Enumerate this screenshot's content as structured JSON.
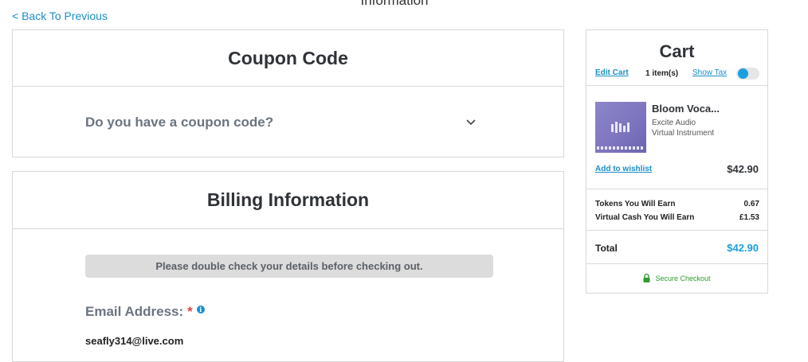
{
  "page": {
    "top_title": "Information",
    "back_link": "< Back To Previous"
  },
  "coupon": {
    "heading": "Coupon Code",
    "question": "Do you have a coupon code?"
  },
  "billing": {
    "heading": "Billing Information",
    "notice": "Please double check your details before checking out.",
    "email_label": "Email Address:",
    "required_mark": "*",
    "info_mark": "i",
    "email_value": "seafly314@live.com"
  },
  "cart": {
    "title": "Cart",
    "edit_cart": "Edit Cart",
    "item_count": "1 item(s)",
    "show_tax": "Show Tax",
    "show_tax_on": true,
    "item": {
      "name": "Bloom Voca...",
      "brand": "Excite Audio",
      "type": "Virtual Instrument",
      "price": "$42.90",
      "wishlist": "Add to wishlist"
    },
    "tokens_label": "Tokens You Will Earn",
    "tokens_value": "0.67",
    "vcash_label": "Virtual Cash You Will Earn",
    "vcash_value": "£1.53",
    "total_label": "Total",
    "total_value": "$42.90",
    "secure_checkout": "Secure Checkout"
  },
  "colors": {
    "accent": "#1a8fc9",
    "secure": "#2e9b2e",
    "required": "#e0424b"
  }
}
